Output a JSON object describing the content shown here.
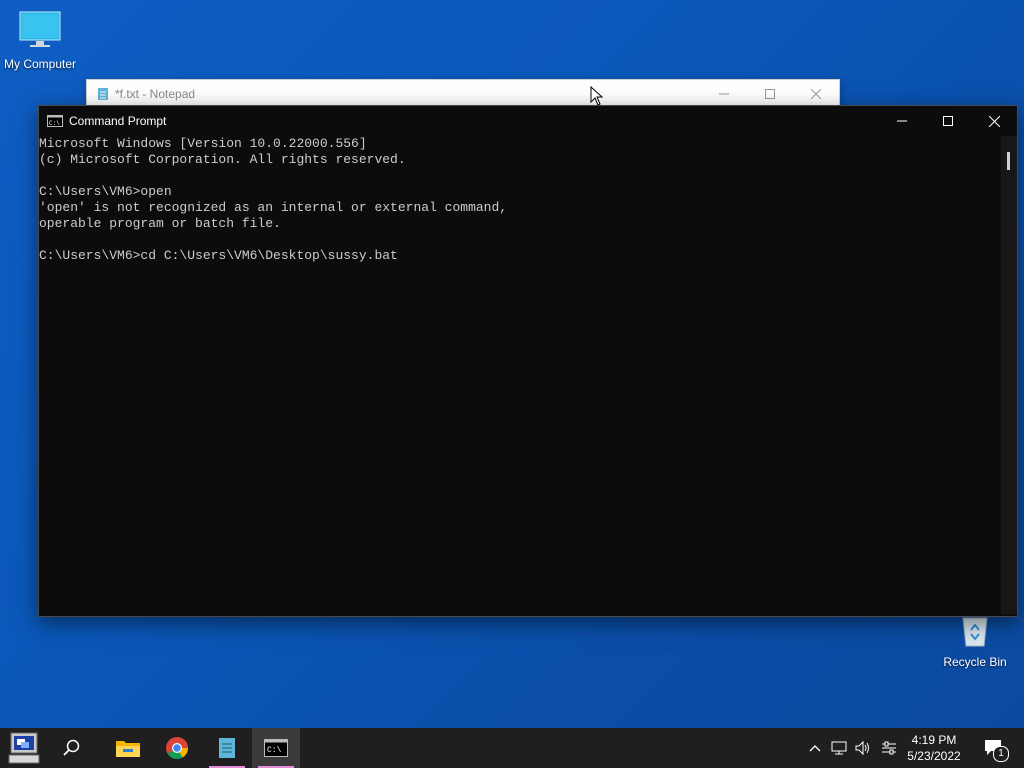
{
  "desktop": {
    "icons": [
      {
        "label": "My Computer",
        "icon": "monitor-icon"
      },
      {
        "label": "Recycle Bin",
        "icon": "recycle-bin-icon"
      }
    ]
  },
  "notepad": {
    "title": "*f.txt - Notepad"
  },
  "cmd": {
    "title": "Command Prompt",
    "lines": [
      "Microsoft Windows [Version 10.0.22000.556]",
      "(c) Microsoft Corporation. All rights reserved.",
      "",
      "C:\\Users\\VM6>open",
      "'open' is not recognized as an internal or external command,",
      "operable program or batch file.",
      "",
      "C:\\Users\\VM6>cd C:\\Users\\VM6\\Desktop\\sussy.bat"
    ]
  },
  "taskbar": {
    "apps": [
      {
        "name": "start",
        "icon": "windows-start-icon"
      },
      {
        "name": "search",
        "icon": "search-icon"
      },
      {
        "name": "file-explorer",
        "icon": "folder-icon"
      },
      {
        "name": "chrome",
        "icon": "chrome-icon"
      },
      {
        "name": "notepad",
        "icon": "notepad-icon"
      },
      {
        "name": "command-prompt",
        "icon": "terminal-icon"
      }
    ],
    "clock": {
      "time": "4:19 PM",
      "date": "5/23/2022"
    },
    "notification_count": "1"
  },
  "colors": {
    "desktop": "#0a57b8",
    "console_bg": "#0c0c0c",
    "console_text": "#cccccc",
    "taskbar": "#1f1f1f",
    "active_underline": "#e38bd7"
  }
}
